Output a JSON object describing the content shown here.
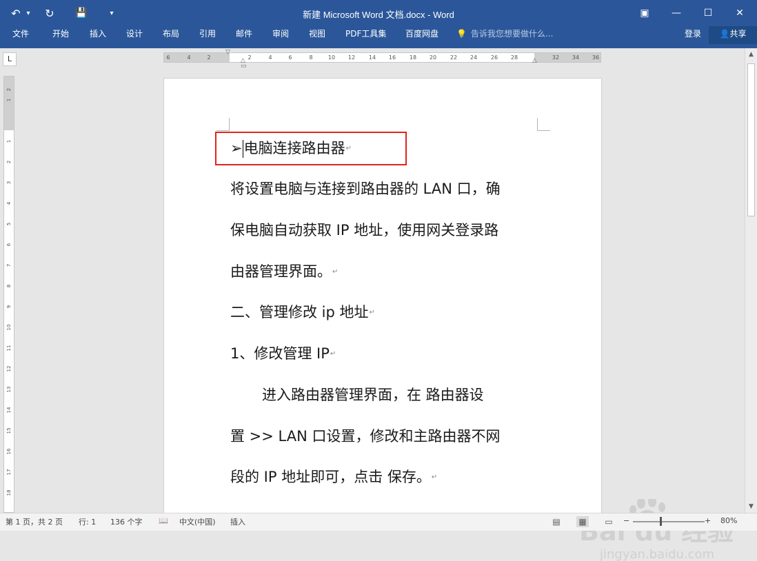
{
  "window": {
    "title": "新建 Microsoft Word 文档.docx - Word",
    "controls": {
      "ribbon_display": "▣",
      "minimize": "—",
      "maximize": "☐",
      "close": "✕"
    }
  },
  "quick_access": {
    "undo": "↶",
    "undo_dropdown": "▾",
    "redo": "↻",
    "save": "💾",
    "customize": "▾"
  },
  "ribbon": {
    "tabs": [
      "文件",
      "开始",
      "插入",
      "设计",
      "布局",
      "引用",
      "邮件",
      "审阅",
      "视图",
      "PDF工具集",
      "百度网盘"
    ],
    "tell_me_icon": "💡",
    "tell_me_placeholder": "告诉我您想要做什么...",
    "signin": "登录",
    "share_icon": "👤",
    "share": "共享"
  },
  "ruler": {
    "corner": "L",
    "ticks": [
      "6",
      "4",
      "2",
      "2",
      "4",
      "6",
      "8",
      "10",
      "12",
      "14",
      "16",
      "18",
      "20",
      "22",
      "24",
      "26",
      "28",
      "32",
      "34",
      "36"
    ],
    "vertical_ticks": [
      "2",
      "1",
      "1",
      "2",
      "3",
      "4",
      "5",
      "6",
      "7",
      "8",
      "9",
      "10",
      "11",
      "12",
      "13",
      "14",
      "15",
      "16",
      "17",
      "18"
    ]
  },
  "document": {
    "heading_bullet": "➢",
    "heading": "电脑连接路由器",
    "lines": [
      "将设置电脑与连接到路由器的 LAN 口，确",
      "保电脑自动获取 IP 地址，使用网关登录路",
      "由器管理界面。",
      "二、管理修改 ip 地址",
      "1、修改管理 IP",
      "进入路由器管理界面，在  路由器设",
      "置  >> LAN 口设置，修改和主路由器不网",
      "段的 IP 地址即可，点击  保存。"
    ],
    "paragraph_mark": "↵"
  },
  "status": {
    "page": "第 1 页，共 2 页",
    "line": "行: 1",
    "words": "136 个字",
    "proof_icon": "📖",
    "language": "中文(中国)",
    "mode": "插入",
    "zoom": "80%",
    "zoom_minus": "−",
    "zoom_plus": "+",
    "zoom_level": 0.8
  },
  "scrollbar": {
    "up": "▲",
    "down": "▼"
  },
  "watermark": {
    "text": "Bai du 经验",
    "url": "jingyan.baidu.com"
  },
  "colors": {
    "title_bar": "#2b579a",
    "highlight_box": "#e0231c",
    "workspace": "#e6e6e6"
  }
}
